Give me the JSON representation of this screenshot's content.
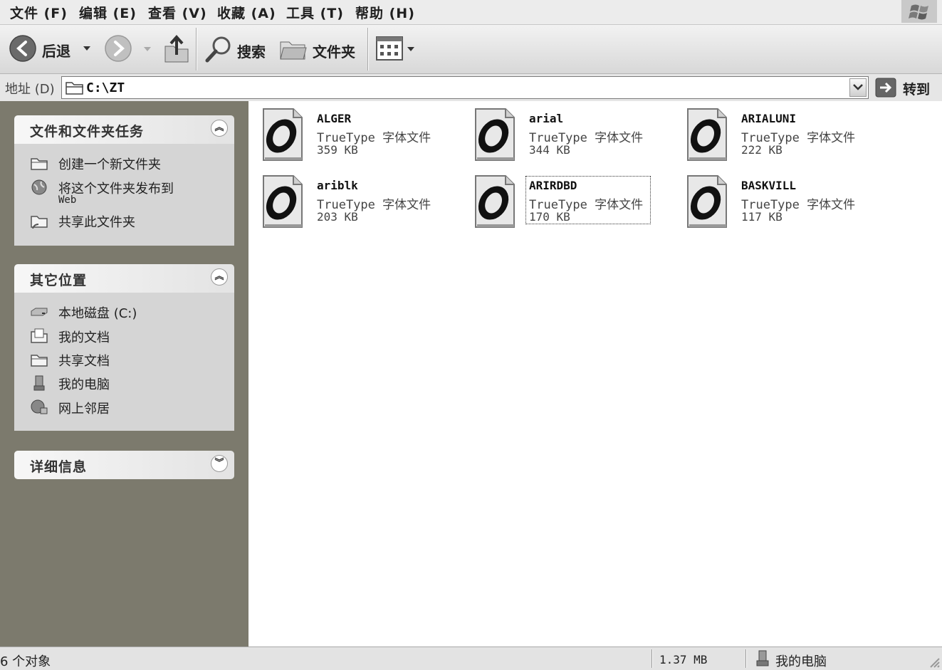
{
  "menu": [
    "文件 (F)",
    "编辑 (E)",
    "查看 (V)",
    "收藏 (A)",
    "工具 (T)",
    "帮助 (H)"
  ],
  "toolbar": {
    "back_label": "后退",
    "search_label": "搜索",
    "folders_label": "文件夹"
  },
  "address": {
    "label": "地址 (D)",
    "path": "C:\\ZT",
    "go_label": "转到"
  },
  "task_panel": {
    "title": "文件和文件夹任务",
    "items": [
      "创建一个新文件夹",
      "将这个文件夹发布到",
      "Web",
      "共享此文件夹"
    ]
  },
  "places_panel": {
    "title": "其它位置",
    "items": [
      "本地磁盘 (C:)",
      "我的文档",
      "共享文档",
      "我的电脑",
      "网上邻居"
    ]
  },
  "details_panel": {
    "title": "详细信息"
  },
  "files": [
    {
      "name": "ALGER",
      "type": "TrueType 字体文件",
      "size": "359 KB"
    },
    {
      "name": "arial",
      "type": "TrueType 字体文件",
      "size": "344 KB"
    },
    {
      "name": "ARIALUNI",
      "type": "TrueType 字体文件",
      "size": "222 KB"
    },
    {
      "name": "ariblk",
      "type": "TrueType 字体文件",
      "size": "203 KB"
    },
    {
      "name": "ARIRDBD",
      "type": "TrueType 字体文件",
      "size": "170 KB",
      "selected": true
    },
    {
      "name": "BASKVILL",
      "type": "TrueType 字体文件",
      "size": "117 KB"
    }
  ],
  "status": {
    "objects": "6 个对象",
    "size": "1.37 MB",
    "location": "我的电脑"
  }
}
